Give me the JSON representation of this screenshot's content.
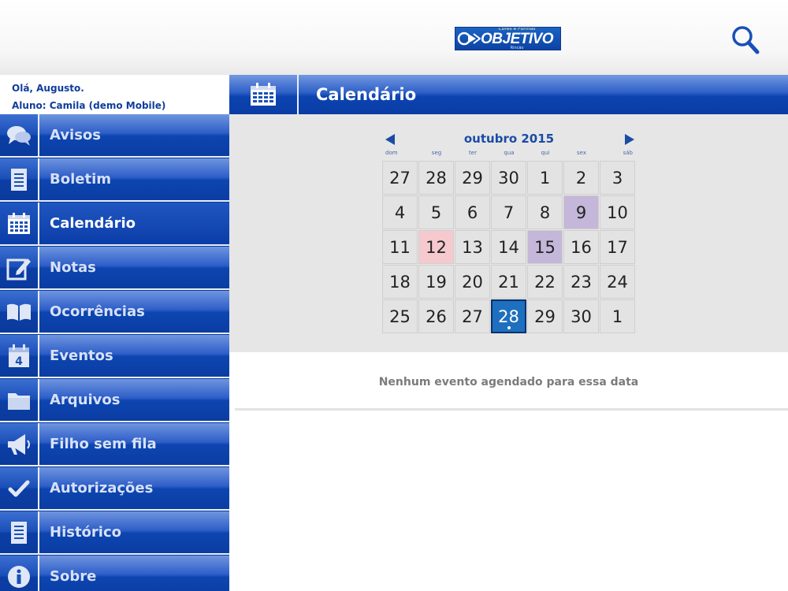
{
  "header": {
    "logo_small": "Cores e Formas",
    "logo_main": "OBJETIVO",
    "logo_tiny": "Rincão",
    "search_icon": "search-icon"
  },
  "user": {
    "greeting": "Olá, Augusto.",
    "student": "Aluno: Camila (demo Mobile)"
  },
  "menu": {
    "items": [
      {
        "label": "Avisos",
        "icon": "chat-bubbles-icon"
      },
      {
        "label": "Boletim",
        "icon": "document-icon"
      },
      {
        "label": "Calendário",
        "icon": "calendar-icon",
        "active": true
      },
      {
        "label": "Notas",
        "icon": "edit-note-icon"
      },
      {
        "label": "Ocorrências",
        "icon": "open-book-icon"
      },
      {
        "label": "Eventos",
        "icon": "event-calendar-icon"
      },
      {
        "label": "Arquivos",
        "icon": "folder-icon"
      },
      {
        "label": "Filho sem fila",
        "icon": "megaphone-icon"
      },
      {
        "label": "Autorizações",
        "icon": "checkmark-icon"
      },
      {
        "label": "Histórico",
        "icon": "history-document-icon"
      },
      {
        "label": "Sobre",
        "icon": "info-icon"
      }
    ]
  },
  "page": {
    "title": "Calendário",
    "title_icon": "calendar-icon"
  },
  "calendar": {
    "month_label": "outubro 2015",
    "weekdays": [
      "dom",
      "seg",
      "ter",
      "qua",
      "qui",
      "sex",
      "sáb"
    ],
    "weeks": [
      [
        "27",
        "28",
        "29",
        "30",
        "1",
        "2",
        "3"
      ],
      [
        "4",
        "5",
        "6",
        "7",
        "8",
        "9",
        "10"
      ],
      [
        "11",
        "12",
        "13",
        "14",
        "15",
        "16",
        "17"
      ],
      [
        "18",
        "19",
        "20",
        "21",
        "22",
        "23",
        "24"
      ],
      [
        "25",
        "26",
        "27",
        "28",
        "29",
        "30",
        "1"
      ]
    ],
    "highlights": {
      "pink": [
        "12"
      ],
      "purple": [
        "9",
        "15"
      ]
    },
    "selected_day": "28",
    "colors": {
      "pink": "#f5c9cd",
      "purple": "#c4b7d9",
      "selected": "#1e6fbe",
      "accent": "#0a3b9e"
    }
  },
  "events": {
    "empty_message": "Nenhum evento agendado para essa data"
  }
}
